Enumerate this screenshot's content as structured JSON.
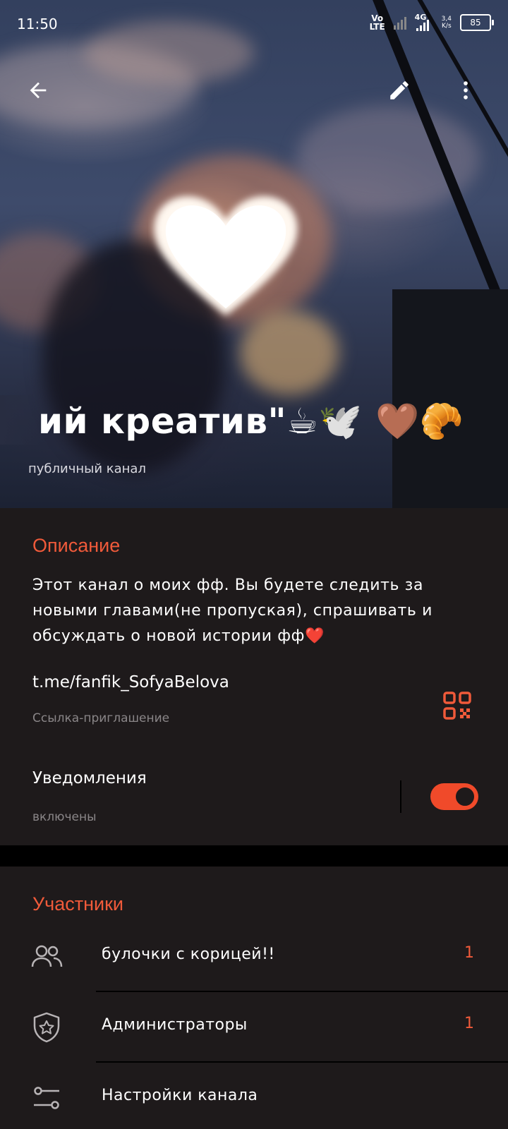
{
  "status_bar": {
    "time": "11:50",
    "volte": "Vo\nLTE",
    "network": "4G",
    "speed_value": "3,4",
    "speed_unit": "K/s",
    "battery": "85"
  },
  "header": {
    "channel_title": "ий креатив\"☕🕊️ 🤎🥐",
    "channel_type": "публичный канал"
  },
  "info": {
    "description_title": "Описание",
    "description_text": "Этот канал о моих фф. Вы будете следить за новыми главами(не пропуская), спрашивать и обсуждать о новой истории фф❤️",
    "link": "t.me/fanfik_SofyaBelova",
    "link_caption": "Ссылка-приглашение",
    "notifications_label": "Уведомления",
    "notifications_state": "включены",
    "notifications_on": true
  },
  "members": {
    "title": "Участники",
    "rows": [
      {
        "label": "булочки с корицей!!",
        "count": "1",
        "icon": "people-icon"
      },
      {
        "label": "Администраторы",
        "count": "1",
        "icon": "shield-star-icon"
      },
      {
        "label": "Настройки канала",
        "count": "",
        "icon": "settings-sliders-icon"
      }
    ]
  },
  "colors": {
    "accent": "#f05a3a",
    "background": "#1e1a1b",
    "secondary_text": "#8a8688"
  }
}
